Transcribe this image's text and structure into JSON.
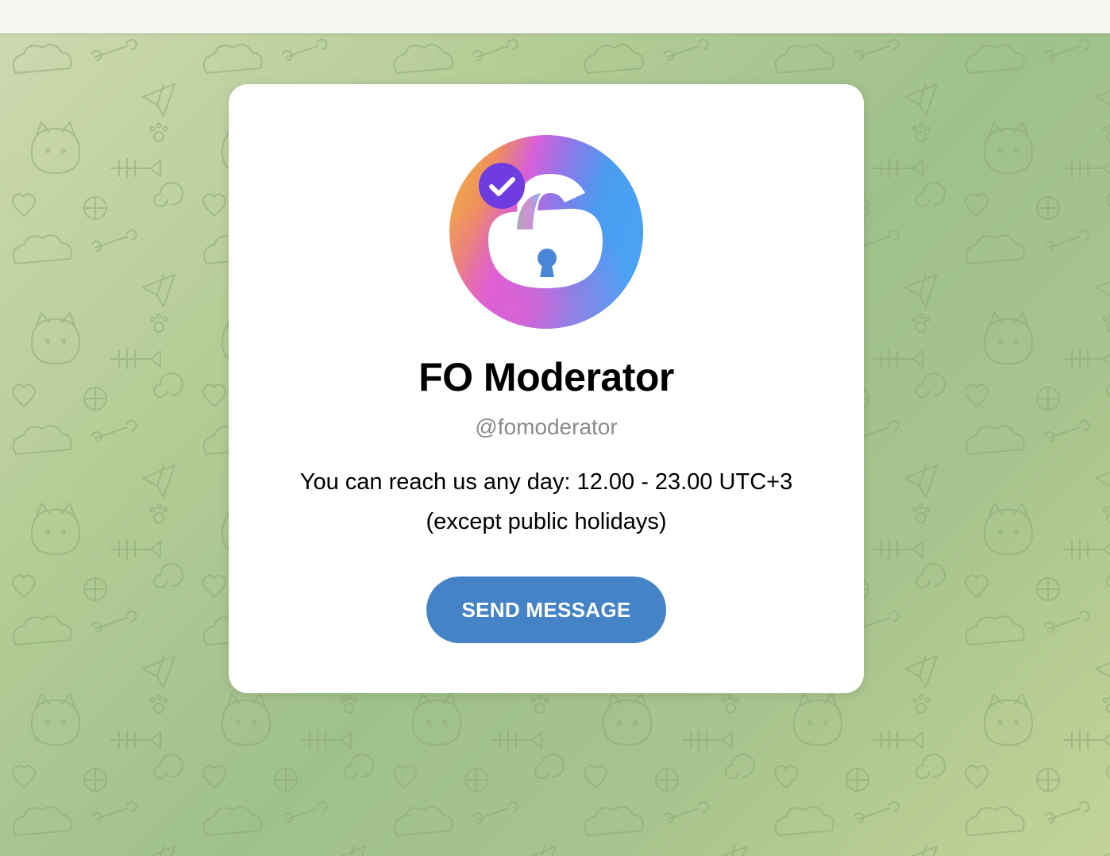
{
  "profile": {
    "name": "FO Moderator",
    "username": "@fomoderator",
    "description_line1": "You can reach us any day: 12.00 - 23.00 UTC+3",
    "description_line2": "(except public holidays)",
    "verified": true
  },
  "actions": {
    "send_message_label": "SEND MESSAGE"
  },
  "colors": {
    "button": "#4583c7",
    "verified_badge": "#6e3ce0",
    "background_pattern": "#a8c48e"
  },
  "icons": {
    "avatar": "padlock-logo-icon",
    "badge": "verified-check-icon"
  }
}
